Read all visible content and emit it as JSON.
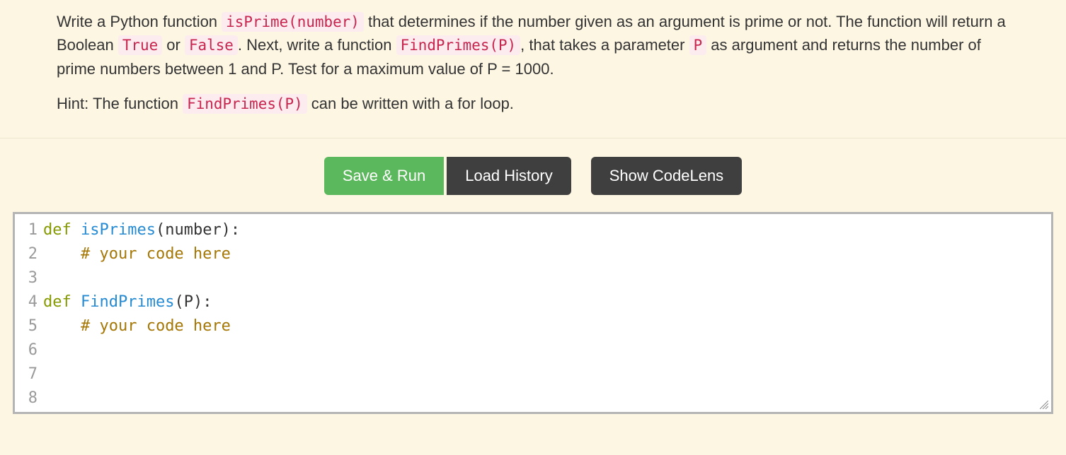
{
  "instructions": {
    "p1_a": "Write a Python function ",
    "code1": "isPrime(number)",
    "p1_b": " that determines if the number given as an argument is prime or not. The function will return a Boolean ",
    "code2": "True",
    "p1_c": " or ",
    "code3": "False",
    "p1_d": ". Next, write a function ",
    "code4": "FindPrimes(P)",
    "p1_e": ", that takes a parameter ",
    "code5": "P",
    "p1_f": " as argument and returns the number of prime numbers between 1 and P. Test for a maximum value of P = 1000.",
    "p2_a": "Hint: The function ",
    "code6": "FindPrimes(P)",
    "p2_b": " can be written with a for loop."
  },
  "buttons": {
    "save_run": "Save & Run",
    "load_history": "Load History",
    "codelens": "Show CodeLens"
  },
  "editor": {
    "line_numbers": [
      "1",
      "2",
      "3",
      "4",
      "5",
      "6",
      "7",
      "8"
    ],
    "l1_def": "def",
    "l1_fn": " isPrimes",
    "l1_rest": "(number):",
    "l2_indent": "    ",
    "l2_cm": "# your code here",
    "l4_def": "def",
    "l4_fn": " FindPrimes",
    "l4_rest": "(P):",
    "l5_indent": "    ",
    "l5_cm": "# your code here"
  }
}
